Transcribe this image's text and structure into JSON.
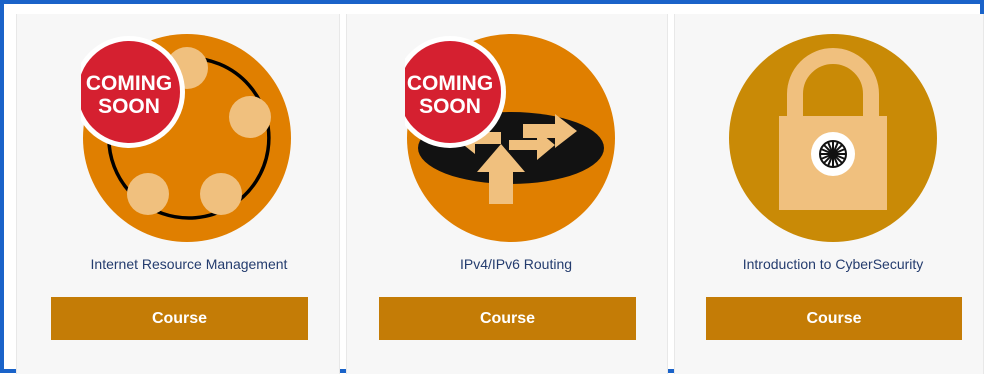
{
  "colors": {
    "frame_border": "#1a63c9",
    "orange": "#e07f00",
    "gold": "#c98a06",
    "peach": "#f0c07e",
    "badge_red": "#d52030",
    "button": "#c47c06",
    "title_text": "#243c6e"
  },
  "cards": [
    {
      "icon": "resource-cycle-icon",
      "badge_line1": "COMING",
      "badge_line2": "SOON",
      "title": "Internet Resource Management",
      "button_label": "Course"
    },
    {
      "icon": "router-arrows-icon",
      "badge_line1": "COMING",
      "badge_line2": "SOON",
      "title": "IPv4/IPv6 Routing",
      "button_label": "Course"
    },
    {
      "icon": "padlock-icon",
      "title": "Introduction to CyberSecurity",
      "button_label": "Course"
    }
  ]
}
